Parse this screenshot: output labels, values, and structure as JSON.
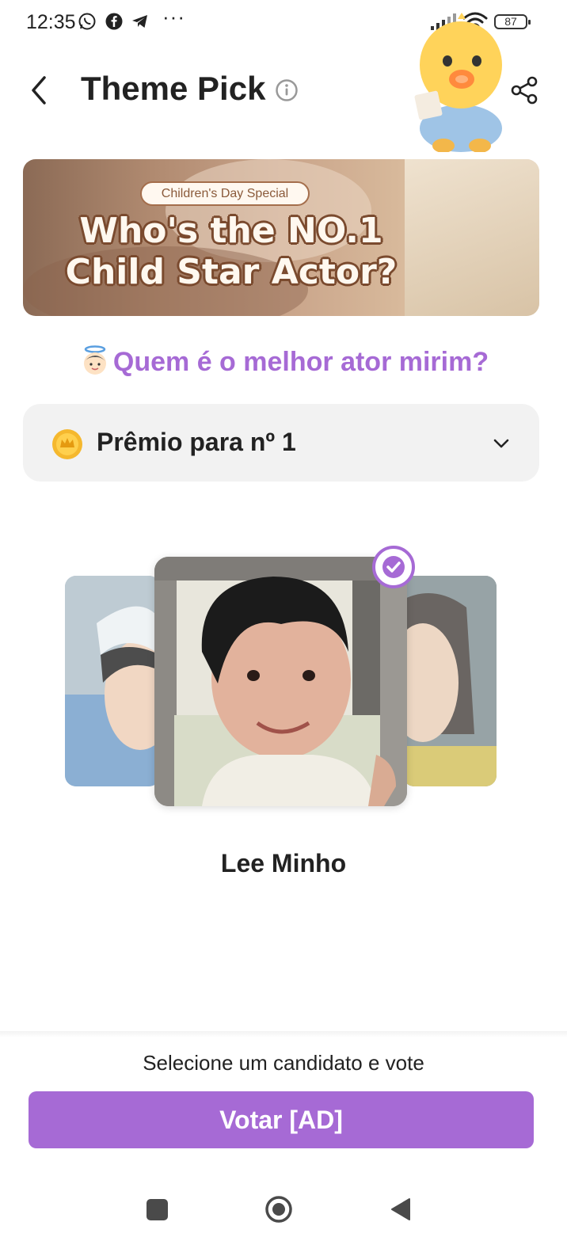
{
  "status_bar": {
    "time": "12:35",
    "battery": "87",
    "icons": [
      "whatsapp-icon",
      "facebook-icon",
      "telegram-icon",
      "more-dots-icon",
      "signal-icon",
      "wifi-icon",
      "battery-icon"
    ],
    "more": "···"
  },
  "header": {
    "title": "Theme Pick",
    "back_icon": "back-arrow-icon",
    "info_icon": "info-icon",
    "share_icon": "share-icon"
  },
  "banner": {
    "tag": "Children's Day Special",
    "headline_line1": "Who's the NO.1",
    "headline_line2": "Child Star Actor?"
  },
  "question": {
    "emoji": "angel-baby-icon",
    "text": "Quem é o melhor ator mirim?"
  },
  "prize": {
    "label": "Prêmio para nº 1",
    "icon": "coin-icon",
    "expand_icon": "chevron-down-icon"
  },
  "carousel": {
    "selected_name": "Lee Minho",
    "selected_icon": "check-icon"
  },
  "footer": {
    "hint": "Selecione um candidato e vote",
    "vote_button": "Votar [AD]"
  },
  "colors": {
    "accent": "#a66ad5",
    "prize_bg": "#f2f2f2",
    "text": "#222222"
  }
}
